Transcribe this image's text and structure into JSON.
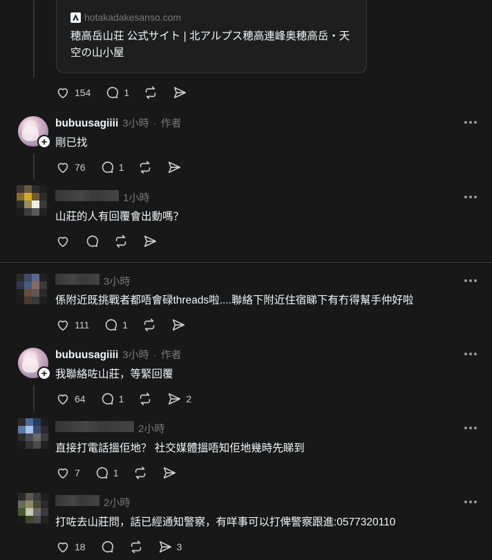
{
  "link_card": {
    "domain": "hotakadakesanso.com",
    "title": "穂高岳山荘 公式サイト | 北アルプス穂高連峰奥穂高岳・天空の山小屋"
  },
  "post_actions": {
    "likes": "154",
    "replies": "1"
  },
  "comments": [
    {
      "username": "bubuusagiiii",
      "time": "3小時",
      "author_tag": "作者",
      "text": "剛已找",
      "likes": "76",
      "replies": "1",
      "shares": ""
    },
    {
      "username": "",
      "time": "1小時",
      "author_tag": "",
      "text": "山莊的人有回覆會出動嗎？",
      "likes": "",
      "replies": "",
      "shares": ""
    },
    {
      "username": "",
      "time": "3小時",
      "author_tag": "",
      "text": "係附近既挑戰者都唔會碌threads啦....聯絡下附近住宿睇下有冇得幫手仲好啦",
      "likes": "111",
      "replies": "1",
      "shares": ""
    },
    {
      "username": "bubuusagiiii",
      "time": "3小時",
      "author_tag": "作者",
      "text": "我聯絡咗山莊，等緊回覆",
      "likes": "64",
      "replies": "1",
      "shares": "2"
    },
    {
      "username": "",
      "time": "2小時",
      "author_tag": "",
      "text": "直接打電話搵佢地？ 社交媒體搵唔知佢地幾時先睇到",
      "likes": "7",
      "replies": "1",
      "shares": ""
    },
    {
      "username": "",
      "time": "2小時",
      "author_tag": "",
      "text": "打咗去山莊問，話已經通知警察，有咩事可以打俾警察跟進:0577320110",
      "likes": "18",
      "replies": "",
      "shares": "3"
    }
  ],
  "icons": {
    "like": "heart-icon",
    "reply": "comment-icon",
    "repost": "repost-icon",
    "share": "share-icon",
    "more": "more-icon",
    "follow": "plus-icon"
  }
}
